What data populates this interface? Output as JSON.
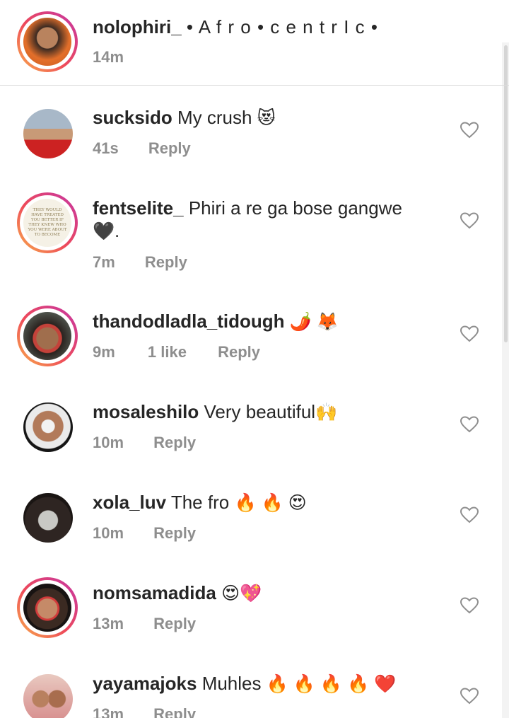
{
  "caption": {
    "username": "nolophiri_",
    "text": "• A f r o • c e n t r I c •",
    "time": "14m"
  },
  "reply_label": "Reply",
  "comments": [
    {
      "username": "sucksido",
      "text": "My crush",
      "emoji": "😻",
      "time": "41s",
      "likes": "",
      "story_ring": false
    },
    {
      "username": "fentselite_",
      "text": "Phiri a re ga bose gangwe",
      "text2": "🖤.",
      "time": "7m",
      "likes": "",
      "story_ring": true,
      "avatar_text": "THEY WOULD HAVE TREATED YOU BETTER IF THEY KNEW WHO YOU WERE ABOUT TO BECOME"
    },
    {
      "username": "thandodladla_tidough",
      "text": "",
      "emoji": "🌶️ 🦊",
      "time": "9m",
      "likes": "1 like",
      "story_ring": true
    },
    {
      "username": "mosaleshilo",
      "text": "Very beautiful",
      "emoji": "🙌",
      "time": "10m",
      "likes": "",
      "story_ring": false
    },
    {
      "username": "xola_luv",
      "text": "The fro",
      "emoji": "🔥 🔥 😍",
      "time": "10m",
      "likes": "",
      "story_ring": false
    },
    {
      "username": "nomsamadida",
      "text": "",
      "emoji": "😍💖",
      "time": "13m",
      "likes": "",
      "story_ring": true
    },
    {
      "username": "yayamajoks",
      "text": "Muhles",
      "emoji": "🔥 🔥 🔥 🔥 ❤️",
      "time": "13m",
      "likes": "",
      "story_ring": false
    }
  ],
  "colors": {
    "text": "#262626",
    "meta": "#8e8e8e",
    "divider": "#dbdbdb",
    "ring_start": "#f9b04a",
    "ring_end": "#c535a5"
  },
  "icons": {
    "like": "heart-outline-icon"
  }
}
